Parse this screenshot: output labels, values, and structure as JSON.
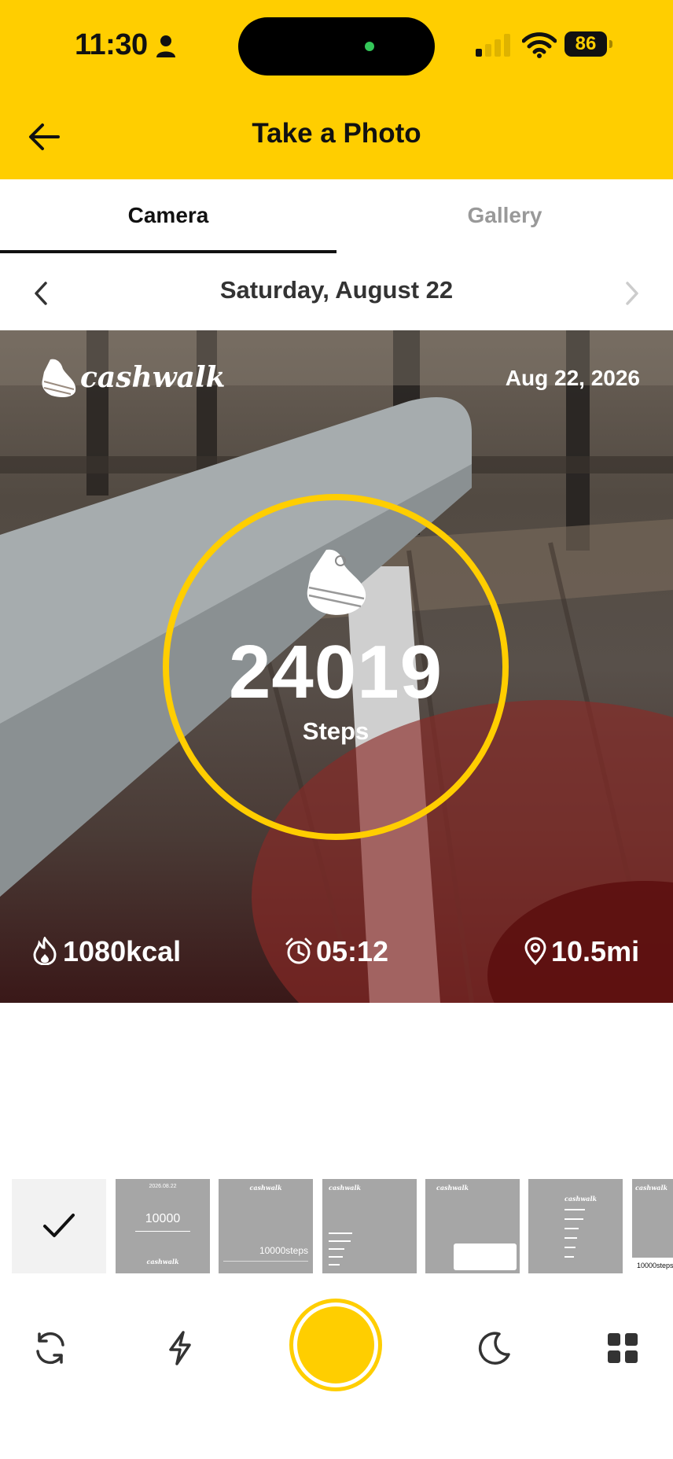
{
  "status_bar": {
    "time": "11:30",
    "battery": "86"
  },
  "header": {
    "title": "Take a Photo"
  },
  "tabs": [
    {
      "label": "Camera",
      "active": true
    },
    {
      "label": "Gallery",
      "active": false
    }
  ],
  "date_nav": {
    "date": "Saturday, August 22"
  },
  "photo": {
    "brand": "cashwalk",
    "date": "Aug 22, 2026",
    "steps": "24019",
    "steps_label": "Steps",
    "calories": "1080kcal",
    "duration": "05:12",
    "distance": "10.5mi"
  },
  "templates": [
    {
      "kind": "none",
      "selected": true
    },
    {
      "kind": "centered",
      "date": "2026.08.22",
      "value": "10000",
      "brand": "cashwalk"
    },
    {
      "kind": "bottom",
      "brand": "cashwalk",
      "value": "10000steps"
    },
    {
      "kind": "list",
      "brand": "cashwalk"
    },
    {
      "kind": "card",
      "brand": "cashwalk"
    },
    {
      "kind": "center-list",
      "brand": "cashwalk"
    },
    {
      "kind": "partial",
      "brand": "cashwalk",
      "value": "10000steps"
    }
  ],
  "colors": {
    "accent": "#FFCE00",
    "text": "#111111",
    "muted": "#999999"
  },
  "icons": [
    "back-arrow-icon",
    "chevron-left-icon",
    "chevron-right-icon",
    "shoe-icon",
    "flame-icon",
    "alarm-clock-icon",
    "location-pin-icon",
    "checkmark-icon",
    "flip-camera-icon",
    "flash-icon",
    "night-mode-icon",
    "grid-icon"
  ]
}
